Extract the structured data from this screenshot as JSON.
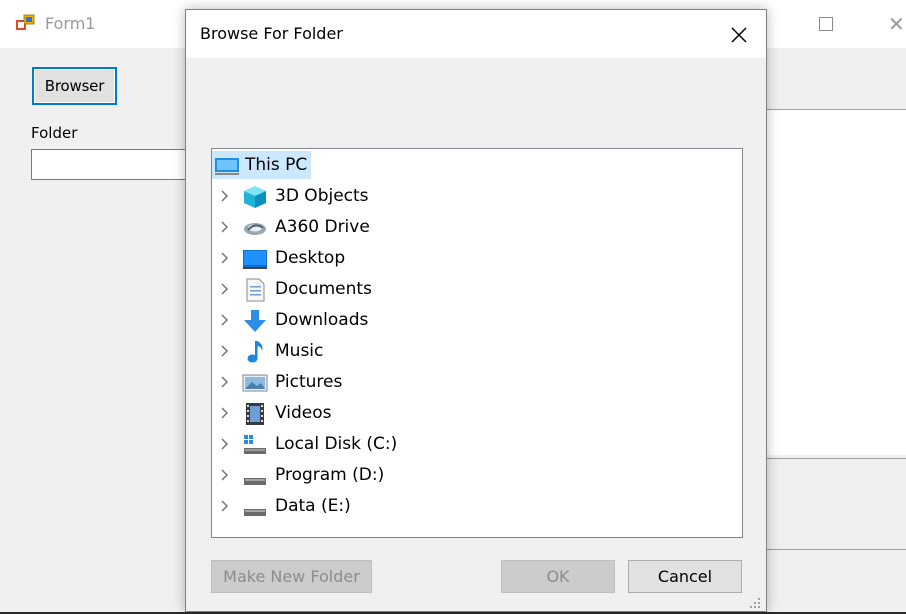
{
  "form1": {
    "title": "Form1",
    "browser_button": "Browser",
    "folder_label": "Folder",
    "folder_value": ""
  },
  "dialog": {
    "title": "Browse For Folder",
    "tree": {
      "root": "This PC",
      "items": [
        {
          "label": "3D Objects",
          "icon": "3d-objects-icon"
        },
        {
          "label": "A360 Drive",
          "icon": "a360-drive-icon"
        },
        {
          "label": "Desktop",
          "icon": "desktop-icon"
        },
        {
          "label": "Documents",
          "icon": "documents-icon"
        },
        {
          "label": "Downloads",
          "icon": "downloads-icon"
        },
        {
          "label": "Music",
          "icon": "music-icon"
        },
        {
          "label": "Pictures",
          "icon": "pictures-icon"
        },
        {
          "label": "Videos",
          "icon": "videos-icon"
        },
        {
          "label": "Local Disk (C:)",
          "icon": "local-disk-icon"
        },
        {
          "label": "Program (D:)",
          "icon": "drive-icon"
        },
        {
          "label": "Data (E:)",
          "icon": "drive-icon"
        }
      ]
    },
    "buttons": {
      "make_new_folder": "Make New Folder",
      "ok": "OK",
      "cancel": "Cancel"
    }
  },
  "colors": {
    "accent": "#0078d7",
    "selection": "#cce8ff",
    "window_bg": "#f0f0f0"
  }
}
